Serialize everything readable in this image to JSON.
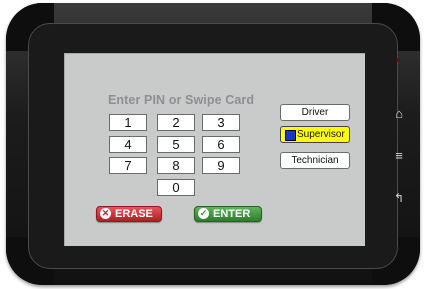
{
  "login": {
    "prompt": "Enter PIN or Swipe Card",
    "keys": [
      "1",
      "2",
      "3",
      "4",
      "5",
      "6",
      "7",
      "8",
      "9",
      "0"
    ],
    "erase_label": "ERASE",
    "enter_label": "ENTER"
  },
  "roles": [
    {
      "label": "Driver",
      "selected": false
    },
    {
      "label": "Supervisor",
      "selected": true
    },
    {
      "label": "Technician",
      "selected": false
    }
  ],
  "hardware_buttons": [
    {
      "icon": "home-icon",
      "glyph": "⌂"
    },
    {
      "icon": "menu-icon",
      "glyph": "≡"
    },
    {
      "icon": "back-icon",
      "glyph": "↰"
    }
  ],
  "colors": {
    "screen_bg": "#c9cbcb",
    "selected_role": "#ffff00",
    "erase": "#c0262d",
    "enter": "#3c9a39"
  }
}
